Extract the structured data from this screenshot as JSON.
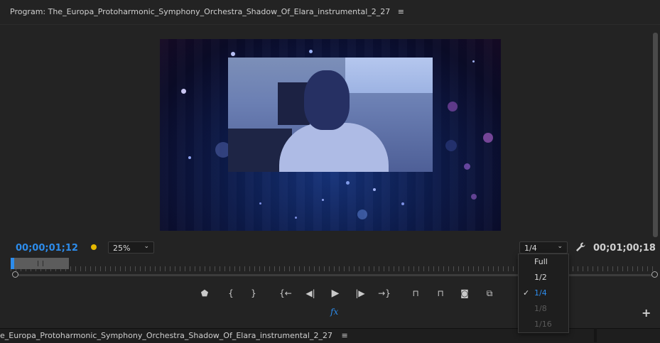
{
  "program_panel": {
    "title": "Program: The_Europa_Protoharmonic_Symphony_Orchestra_Shadow_Of_Elara_instrumental_2_27",
    "menu_icon": "≡"
  },
  "viewer": {
    "current_timecode": "00;00;01;12",
    "duration_timecode": "00;01;00;18",
    "zoom": {
      "selected": "25%"
    },
    "resolution": {
      "selected": "1/4"
    }
  },
  "resolution_menu": {
    "options": [
      {
        "label": "Full",
        "state": "enabled"
      },
      {
        "label": "1/2",
        "state": "enabled"
      },
      {
        "label": "1/4",
        "state": "checked"
      },
      {
        "label": "1/8",
        "state": "disabled"
      },
      {
        "label": "1/16",
        "state": "disabled"
      }
    ]
  },
  "transport": {
    "buttons": [
      {
        "name": "add-marker-button",
        "icon": "marker-icon",
        "glyph": "⬟"
      },
      {
        "name": "mark-in-button",
        "icon": "mark-in-icon",
        "glyph": "{"
      },
      {
        "name": "mark-out-button",
        "icon": "mark-out-icon",
        "glyph": "}"
      },
      {
        "name": "go-to-in-button",
        "icon": "go-to-in-icon",
        "glyph": "{←"
      },
      {
        "name": "step-back-button",
        "icon": "step-back-icon",
        "glyph": "◀|"
      },
      {
        "name": "play-button",
        "icon": "play-icon",
        "glyph": "▶"
      },
      {
        "name": "step-forward-button",
        "icon": "step-forward-icon",
        "glyph": "|▶"
      },
      {
        "name": "go-to-out-button",
        "icon": "go-to-out-icon",
        "glyph": "→}"
      },
      {
        "name": "lift-button",
        "icon": "lift-icon",
        "glyph": "⊓"
      },
      {
        "name": "extract-button",
        "icon": "extract-icon",
        "glyph": "⊓"
      },
      {
        "name": "export-frame-button",
        "icon": "camera-icon",
        "glyph": "◙"
      },
      {
        "name": "comparison-view-button",
        "icon": "comparison-icon",
        "glyph": "⧉"
      }
    ],
    "fx_label": "fx",
    "add_button": "+"
  },
  "timeline_panel": {
    "title": "e_Europa_Protoharmonic_Symphony_Orchestra_Shadow_Of_Elara_instrumental_2_27",
    "menu_icon": "≡"
  },
  "colors": {
    "accent_blue": "#2d8ceb",
    "marker_yellow": "#e6b800",
    "panel_bg": "#232323"
  }
}
